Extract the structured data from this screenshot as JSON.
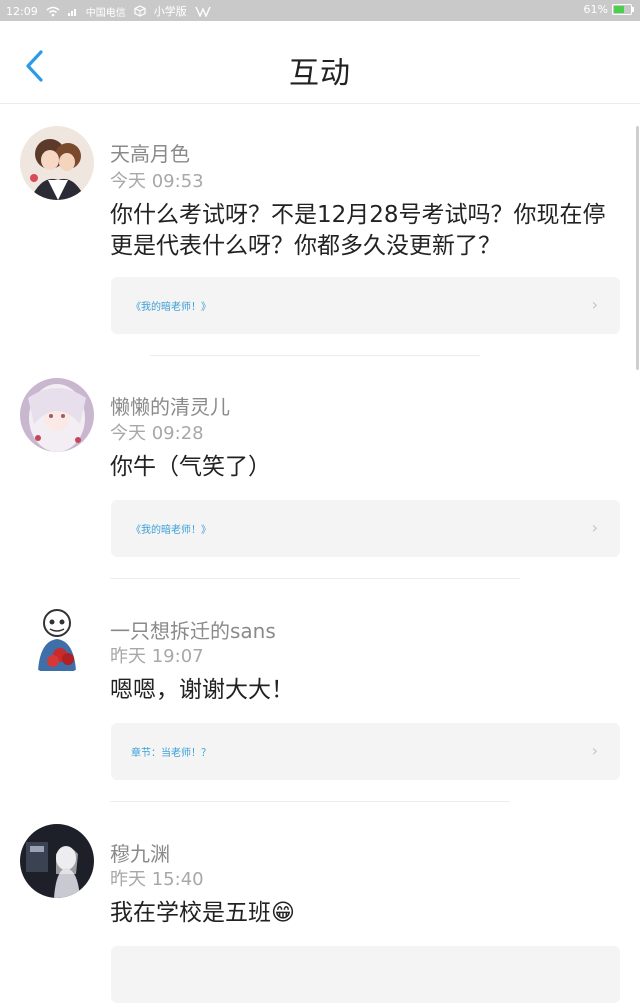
{
  "status_bar": {
    "time": "12:09",
    "carrier": "中国电信",
    "app_label": "小学版",
    "battery": "61%",
    "battery_level": 0.61,
    "battery_color": "#49d14b"
  },
  "header": {
    "title": "互动",
    "back_icon": "chevron-left-icon",
    "accent": "#2a9be8"
  },
  "comments": [
    {
      "user": "天高月色",
      "time": "今天 09:53",
      "message": "你什么考试呀？不是12月28号考试吗？你现在停更是代表什么呀？你都多久没更新了？",
      "link": "《我的暗老师！》"
    },
    {
      "user": "懒懒的清灵儿",
      "time": "今天 09:28",
      "message": "你牛（气笑了）",
      "link": "《我的暗老师！》"
    },
    {
      "user": "一只想拆迁的sans",
      "time": "昨天 19:07",
      "message": "嗯嗯，谢谢大大！",
      "link": "章节：当老师！？"
    },
    {
      "user": "穆九渊",
      "time": "昨天 15:40",
      "message": "我在学校是五班",
      "emoji": "😁"
    }
  ]
}
